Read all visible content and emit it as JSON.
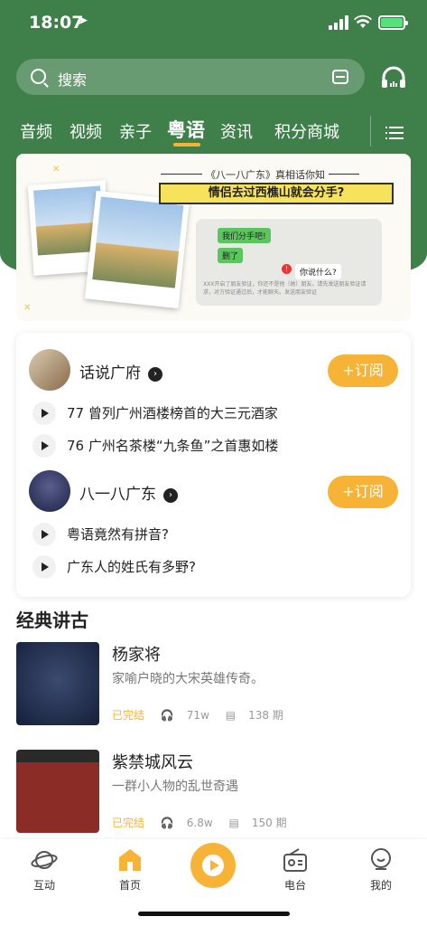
{
  "status": {
    "time": "18:07",
    "location_icon": "navigation-arrow-icon",
    "battery": "charging"
  },
  "search": {
    "placeholder": "搜索"
  },
  "tabs": [
    {
      "label": "音频"
    },
    {
      "label": "视频"
    },
    {
      "label": "亲子"
    },
    {
      "label": "粤语",
      "active": true
    },
    {
      "label": "资讯"
    },
    {
      "label": "积分商城"
    }
  ],
  "banner": {
    "title": "《八一八广东》真相话你知",
    "headline": "情侣去过西樵山就会分手?",
    "chat": [
      "我们分手吧!",
      "删了",
      "你说什么?"
    ],
    "system_note": "XXX开启了朋友验证，你还不是他（她）朋友。请先发送朋友验证请求，对方验证通过后，才能聊天。发送朋友验证"
  },
  "programs": [
    {
      "title": "话说广府",
      "subscribe": "订阅",
      "episodes": [
        "77 曾列广州酒楼榜首的大三元酒家",
        "76 广州名茶楼“九条鱼”之首惠如楼"
      ]
    },
    {
      "title": "八一八广东",
      "subscribe": "订阅",
      "episodes": [
        "粤语竟然有拼音?",
        "广东人的姓氏有多野?"
      ]
    }
  ],
  "section": {
    "title": "经典讲古"
  },
  "books": [
    {
      "title": "杨家将",
      "desc": "家喻户晓的大宋英雄传奇。",
      "status": "已完结",
      "plays": "71w",
      "episodes": "138 期"
    },
    {
      "title": "紫禁城风云",
      "desc": "一群小人物的乱世奇遇",
      "status": "已完结",
      "plays": "6.8w",
      "episodes": "150 期"
    }
  ],
  "nav": [
    {
      "label": "互动",
      "icon": "planet-icon"
    },
    {
      "label": "首页",
      "icon": "home-icon",
      "active": true
    },
    {
      "label": "",
      "icon": "play-circle-icon"
    },
    {
      "label": "电台",
      "icon": "radio-icon"
    },
    {
      "label": "我的",
      "icon": "profile-icon"
    }
  ],
  "colors": {
    "brand_green": "#3e7f4a",
    "accent": "#f6b335"
  }
}
